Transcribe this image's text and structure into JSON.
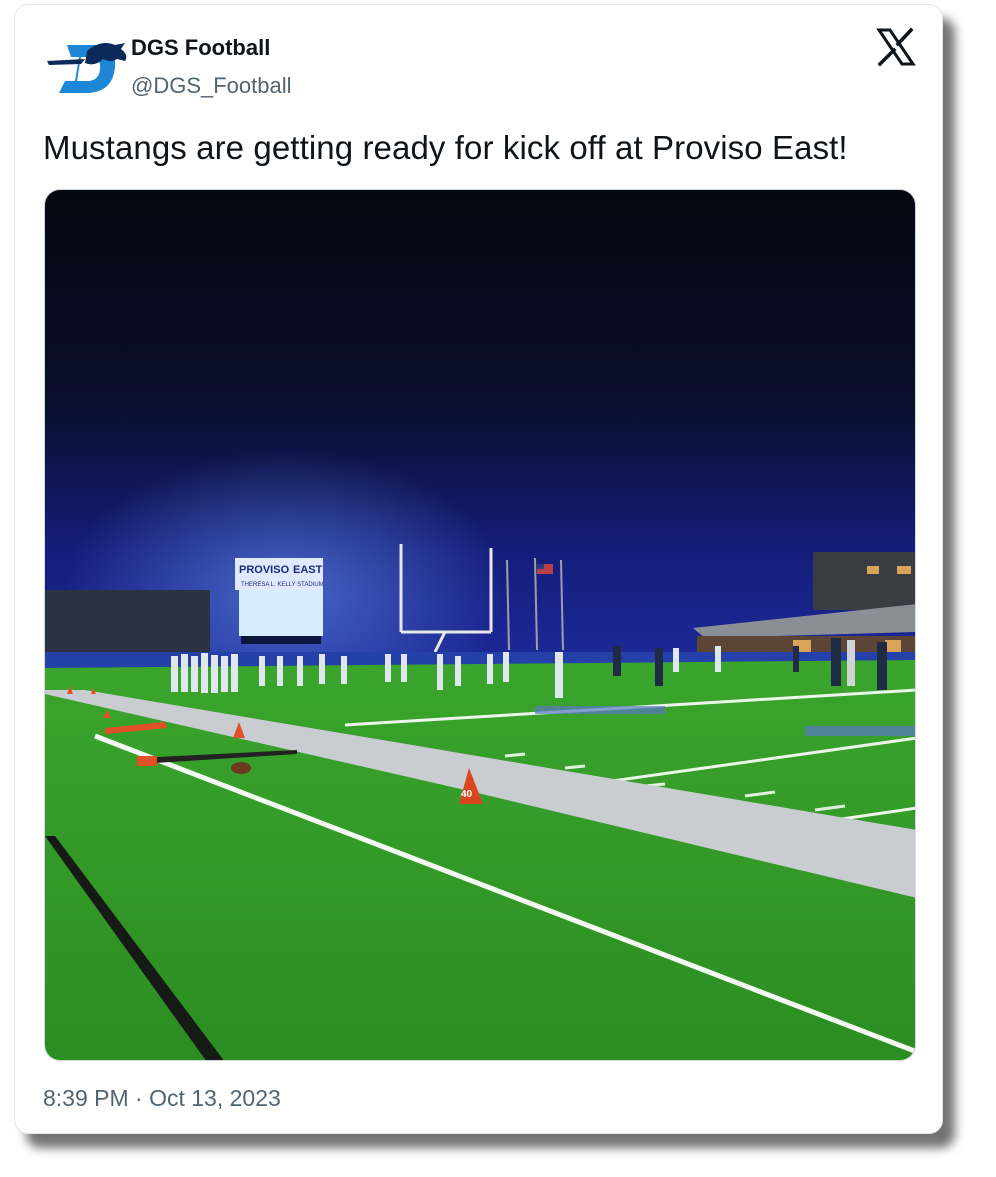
{
  "author": {
    "name": "DGS Football",
    "handle": "@DGS_Football",
    "avatar_icon": "mustang-d-logo-icon"
  },
  "platform_icon": "x-logo-icon",
  "tweet": {
    "text": "Mustangs are getting ready for kick off at Proviso East!",
    "timestamp": "8:39 PM · Oct 13, 2023"
  },
  "photo": {
    "scoreboard_title_left": "PROVISO",
    "scoreboard_title_right": "EAST",
    "scoreboard_subtitle": "THERESA L. KELLY STADIUM",
    "cone_number": "40"
  },
  "colors": {
    "brand_blue": "#1e86d6",
    "text_primary": "#0f1419",
    "text_secondary": "#536471",
    "night_sky": "#0a0f2e",
    "turf_green": "#2f9a26"
  }
}
